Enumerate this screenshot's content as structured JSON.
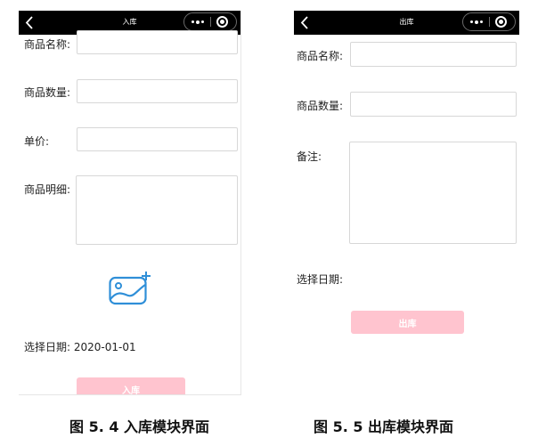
{
  "inbound": {
    "nav_title": "入库",
    "name_label": "商品名称:",
    "qty_label": "商品数量:",
    "price_label": "单价:",
    "detail_label": "商品明细:",
    "date_label": "选择日期:",
    "date_value": "2020-01-01",
    "submit_label": "入库"
  },
  "outbound": {
    "nav_title": "出库",
    "name_label": "商品名称:",
    "qty_label": "商品数量:",
    "note_label": "备注:",
    "date_label": "选择日期:",
    "submit_label": "出库"
  },
  "captions": {
    "left": "图 5. 4  入库模块界面",
    "right": "图 5. 5  出库模块界面"
  },
  "colors": {
    "navbar": "#000000",
    "button": "#ffc4cf",
    "icon": "#2f8fd8"
  }
}
